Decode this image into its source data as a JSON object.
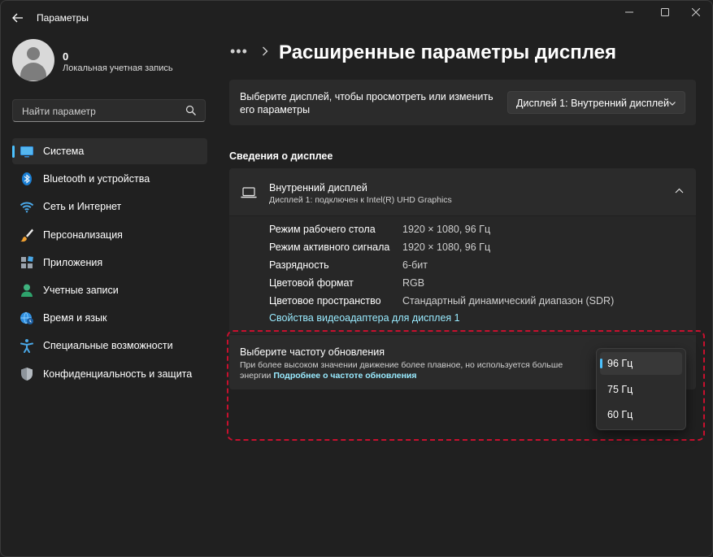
{
  "app": {
    "title": "Параметры"
  },
  "user": {
    "name": "0",
    "account_type": "Локальная учетная запись"
  },
  "search": {
    "placeholder": "Найти параметр"
  },
  "sidebar": {
    "items": [
      {
        "label": "Система",
        "icon": "system-icon"
      },
      {
        "label": "Bluetooth и устройства",
        "icon": "bluetooth-icon"
      },
      {
        "label": "Сеть и Интернет",
        "icon": "wifi-icon"
      },
      {
        "label": "Персонализация",
        "icon": "brush-icon"
      },
      {
        "label": "Приложения",
        "icon": "apps-icon"
      },
      {
        "label": "Учетные записи",
        "icon": "accounts-icon"
      },
      {
        "label": "Время и язык",
        "icon": "globe-clock-icon"
      },
      {
        "label": "Специальные возможности",
        "icon": "accessibility-icon"
      },
      {
        "label": "Конфиденциальность и защита",
        "icon": "shield-icon"
      }
    ]
  },
  "header": {
    "breadcrumb_dots": "•••",
    "title": "Расширенные параметры дисплея"
  },
  "display_select": {
    "description": "Выберите дисплей, чтобы просмотреть или изменить его параметры",
    "selected": "Дисплей 1: Внутренний дисплей"
  },
  "display_info": {
    "section_title": "Сведения о дисплее",
    "name": "Внутренний дисплей",
    "subtitle": "Дисплей 1: подключен к Intel(R) UHD Graphics",
    "rows": [
      {
        "label": "Режим рабочего стола",
        "value": "1920 × 1080, 96 Гц"
      },
      {
        "label": "Режим активного сигнала",
        "value": "1920 × 1080, 96 Гц"
      },
      {
        "label": "Разрядность",
        "value": "6-бит"
      },
      {
        "label": "Цветовой формат",
        "value": "RGB"
      },
      {
        "label": "Цветовое пространство",
        "value": "Стандартный динамический диапазон (SDR)"
      }
    ],
    "adapter_link": "Свойства видеоадаптера для дисплея 1"
  },
  "refresh_rate": {
    "title": "Выберите частоту обновления",
    "description": "При более высоком значении движение более плавное, но используется больше энергии",
    "learn_more": "Подробнее о частоте обновления",
    "options": [
      "96 Гц",
      "75 Гц",
      "60 Гц"
    ],
    "selected": "96 Гц"
  },
  "colors": {
    "accent": "#4cc2ff",
    "link": "#99ebff",
    "highlight_border": "#c8102e"
  }
}
